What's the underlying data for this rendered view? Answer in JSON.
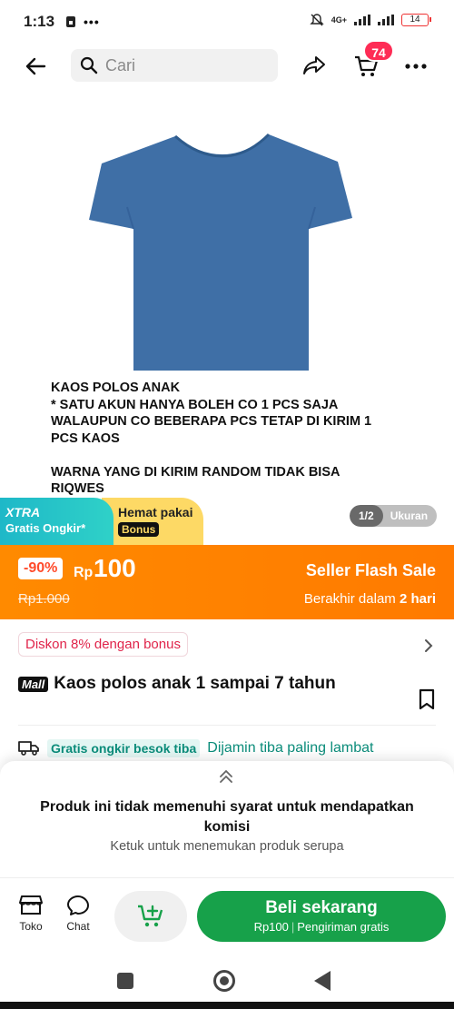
{
  "status": {
    "time": "1:13",
    "network": "4G+",
    "battery": "14"
  },
  "search": {
    "placeholder": "Cari"
  },
  "cart": {
    "badge_count": "74"
  },
  "product": {
    "description": "KAOS POLOS ANAK\n* SATU AKUN HANYA BOLEH CO 1 PCS SAJA\nWALAUPUN CO BEBERAPA PCS TETAP DI KIRIM 1 PCS KAOS\n\nWARNA YANG DI KIRIM RANDOM TIDAK BISA RIQWES",
    "image_color": "#3f6fa6",
    "title": "Kaos polos anak 1 sampai 7 tahun",
    "mall_badge": "Mall"
  },
  "promo": {
    "xtra_title": "XTRA",
    "xtra_sub": "Gratis Ongkir*",
    "hemat_title": "Hemat pakai",
    "hemat_bonus": "Bonus",
    "page_count": "1/2",
    "page_label": "Ukuran"
  },
  "flash_sale": {
    "discount": "-90%",
    "currency": "Rp",
    "price": "100",
    "old_price": "Rp1.000",
    "title": "Seller Flash Sale",
    "ends_prefix": "Berakhir dalam",
    "ends_value": "2 hari"
  },
  "info": {
    "discount_chip": "Diskon 8% dengan bonus",
    "shipping_chip": "Gratis ongkir besok tiba",
    "shipping_guarantee": "Dijamin tiba paling lambat"
  },
  "commission": {
    "title": "Produk ini tidak memenuhi syarat untuk mendapatkan komisi",
    "subtitle": "Ketuk untuk menemukan produk serupa"
  },
  "actionbar": {
    "shop_label": "Toko",
    "chat_label": "Chat",
    "buy_label": "Beli sekarang",
    "buy_price": "Rp100",
    "buy_shipping": "Pengiriman gratis"
  },
  "colors": {
    "flash_orange": "#ff8a00",
    "buy_green": "#17a14a",
    "badge_red": "#fe2c55",
    "teal": "#1eb8c8"
  }
}
